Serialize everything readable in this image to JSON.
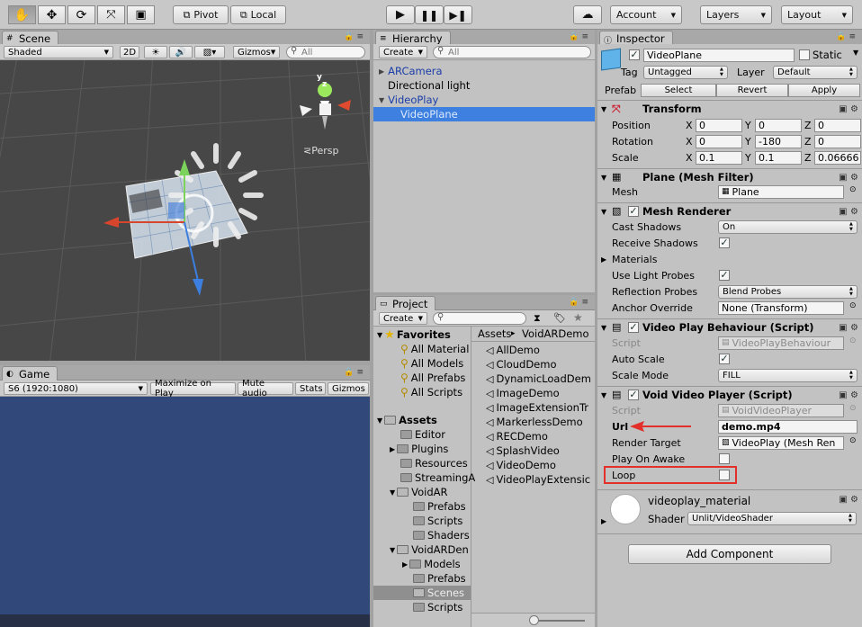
{
  "toolbar": {
    "pivot": "Pivot",
    "local": "Local",
    "account": "Account",
    "layers": "Layers",
    "layout": "Layout"
  },
  "scene": {
    "tab": "Scene",
    "shading": "Shaded",
    "mode2d": "2D",
    "gizmos": "Gizmos",
    "search_placeholder": "All",
    "persp": "Persp",
    "axis_y": "y",
    "axis_z": "z"
  },
  "game": {
    "tab": "Game",
    "resolution": "S6 (1920:1080)",
    "maximize": "Maximize on Play",
    "mute": "Mute audio",
    "stats": "Stats",
    "gizmos": "Gizmos"
  },
  "hierarchy": {
    "tab": "Hierarchy",
    "create": "Create",
    "search_placeholder": "All",
    "items": [
      "ARCamera",
      "Directional light",
      "VideoPlay",
      "VideoPlane"
    ]
  },
  "project": {
    "tab": "Project",
    "create": "Create",
    "favorites": {
      "label": "Favorites",
      "items": [
        "All Material",
        "All Models",
        "All Prefabs",
        "All Scripts"
      ]
    },
    "assets": {
      "label": "Assets",
      "items": [
        "Editor",
        "Plugins",
        "Resources",
        "StreamingA",
        "VoidAR",
        "Prefabs",
        "Scripts",
        "Shaders",
        "VoidARDen",
        "Models",
        "Prefabs",
        "Scenes",
        "Scripts"
      ]
    },
    "breadcrumb": [
      "Assets",
      "VoidARDemo"
    ],
    "files": [
      "AllDemo",
      "CloudDemo",
      "DynamicLoadDem",
      "ImageDemo",
      "ImageExtensionTr",
      "MarkerlessDemo",
      "RECDemo",
      "SplashVideo",
      "VideoDemo",
      "VideoPlayExtensic"
    ]
  },
  "inspector": {
    "tab": "Inspector",
    "name": "VideoPlane",
    "static": "Static",
    "tag_label": "Tag",
    "tag": "Untagged",
    "layer_label": "Layer",
    "layer": "Default",
    "prefab_label": "Prefab",
    "select": "Select",
    "revert": "Revert",
    "apply": "Apply",
    "transform": {
      "title": "Transform",
      "position": "Position",
      "rotation": "Rotation",
      "scale": "Scale",
      "x": "X",
      "y": "Y",
      "z": "Z",
      "pos": [
        "0",
        "0",
        "0"
      ],
      "rot": [
        "0",
        "-180",
        "0"
      ],
      "scl": [
        "0.1",
        "0.1",
        "0.06666"
      ]
    },
    "mesh_filter": {
      "title": "Plane (Mesh Filter)",
      "mesh_label": "Mesh",
      "mesh": "Plane"
    },
    "mesh_renderer": {
      "title": "Mesh Renderer",
      "cast": "Cast Shadows",
      "cast_val": "On",
      "receive": "Receive Shadows",
      "materials": "Materials",
      "light_probes": "Use Light Probes",
      "reflection": "Reflection Probes",
      "reflection_val": "Blend Probes",
      "anchor": "Anchor Override",
      "anchor_val": "None (Transform)"
    },
    "vpb": {
      "title": "Video Play Behaviour (Script)",
      "script_label": "Script",
      "script": "VideoPlayBehaviour",
      "auto_scale": "Auto Scale",
      "scale_mode": "Scale Mode",
      "scale_mode_val": "FILL"
    },
    "vvp": {
      "title": "Void Video Player (Script)",
      "script_label": "Script",
      "script": "VoidVideoPlayer",
      "url_label": "Url",
      "url": "demo.mp4",
      "render_target": "Render Target",
      "render_target_val": "VideoPlay (Mesh Ren",
      "play_on_awake": "Play On Awake",
      "loop": "Loop"
    },
    "material": {
      "name": "videoplay_material",
      "shader_label": "Shader",
      "shader": "Unlit/VideoShader"
    },
    "add_component": "Add Component"
  }
}
